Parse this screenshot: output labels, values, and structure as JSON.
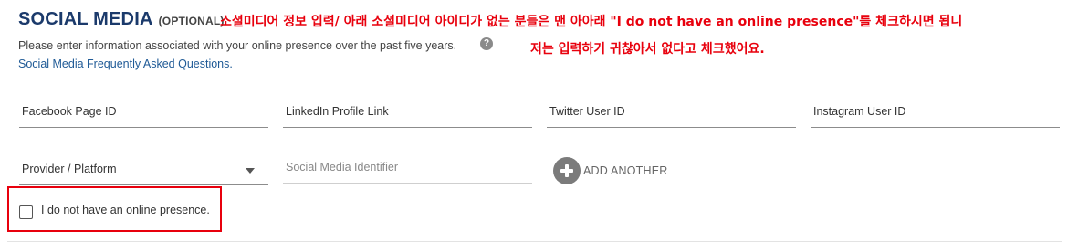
{
  "header": {
    "title": "SOCIAL MEDIA",
    "optional": "(OPTIONAL)",
    "annotation_1": "소셜미디어 정보 입력/ 아래 소셜미디어 아이디가 없는 분들은 맨 아아래 \"I do not have an online presence\"를 체크하시면 됩니",
    "annotation_2": "저는 입력하기 귀찮아서 없다고 체크했어요.",
    "intro": "Please enter information associated with your online presence over the past five years.",
    "help_icon_glyph": "?",
    "faq_link": "Social Media Frequently Asked Questions."
  },
  "fields": {
    "facebook": "Facebook Page ID",
    "linkedin": "LinkedIn Profile Link",
    "twitter": "Twitter User ID",
    "instagram": "Instagram User ID",
    "provider": "Provider / Platform",
    "identifier": "Social Media Identifier"
  },
  "actions": {
    "add_another": "ADD ANOTHER"
  },
  "checkbox": {
    "label": "I do not have an online presence.",
    "checked": false
  },
  "colors": {
    "title": "#1b3a6b",
    "annotation": "#e8000d",
    "link": "#1f5a96",
    "highlight": "#e8000d"
  },
  "icons": {
    "help": "help-icon",
    "add": "plus-circle-icon",
    "dropdown": "caret-down-icon"
  }
}
